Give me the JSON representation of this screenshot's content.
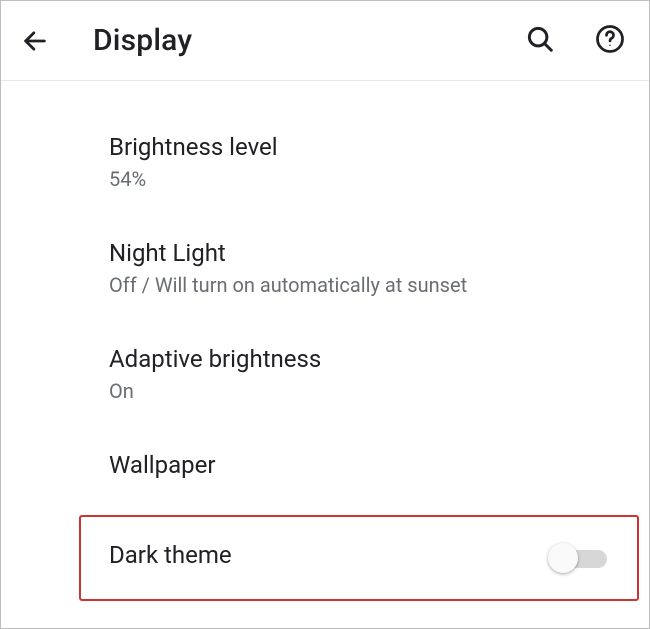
{
  "header": {
    "title": "Display"
  },
  "settings": {
    "brightness": {
      "label": "Brightness level",
      "value": "54%"
    },
    "night_light": {
      "label": "Night Light",
      "value": "Off / Will turn on automatically at sunset"
    },
    "adaptive": {
      "label": "Adaptive brightness",
      "value": "On"
    },
    "wallpaper": {
      "label": "Wallpaper"
    },
    "dark_theme": {
      "label": "Dark theme",
      "enabled": false
    }
  }
}
